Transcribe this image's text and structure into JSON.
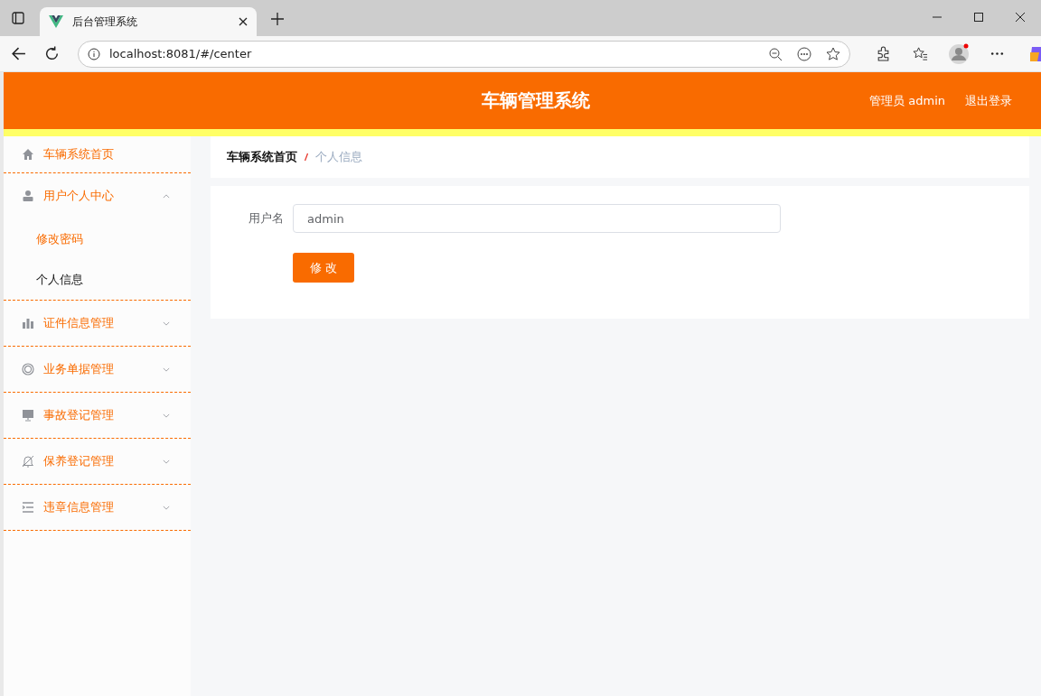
{
  "browser": {
    "tab_title": "后台管理系统",
    "url": "localhost:8081/#/center"
  },
  "header": {
    "title": "车辆管理系统",
    "user": "管理员 admin",
    "logout": "退出登录"
  },
  "sidebar": {
    "items": [
      {
        "kind": "link",
        "label": "车辆系统首页"
      },
      {
        "kind": "submenu",
        "label": "用户个人中心",
        "expanded": true,
        "children": [
          {
            "label": "修改密码",
            "selected": false
          },
          {
            "label": "个人信息",
            "selected": true
          }
        ]
      },
      {
        "kind": "submenu",
        "label": "证件信息管理",
        "expanded": false
      },
      {
        "kind": "submenu",
        "label": "业务单据管理",
        "expanded": false
      },
      {
        "kind": "submenu",
        "label": "事故登记管理",
        "expanded": false
      },
      {
        "kind": "submenu",
        "label": "保养登记管理",
        "expanded": false
      },
      {
        "kind": "submenu",
        "label": "违章信息管理",
        "expanded": false
      }
    ]
  },
  "breadcrumb": [
    {
      "label": "车辆系统首页"
    },
    {
      "label": "个人信息"
    }
  ],
  "form": {
    "fields": [
      {
        "label": "用户名",
        "value": "admin"
      }
    ],
    "button": "修 改"
  }
}
